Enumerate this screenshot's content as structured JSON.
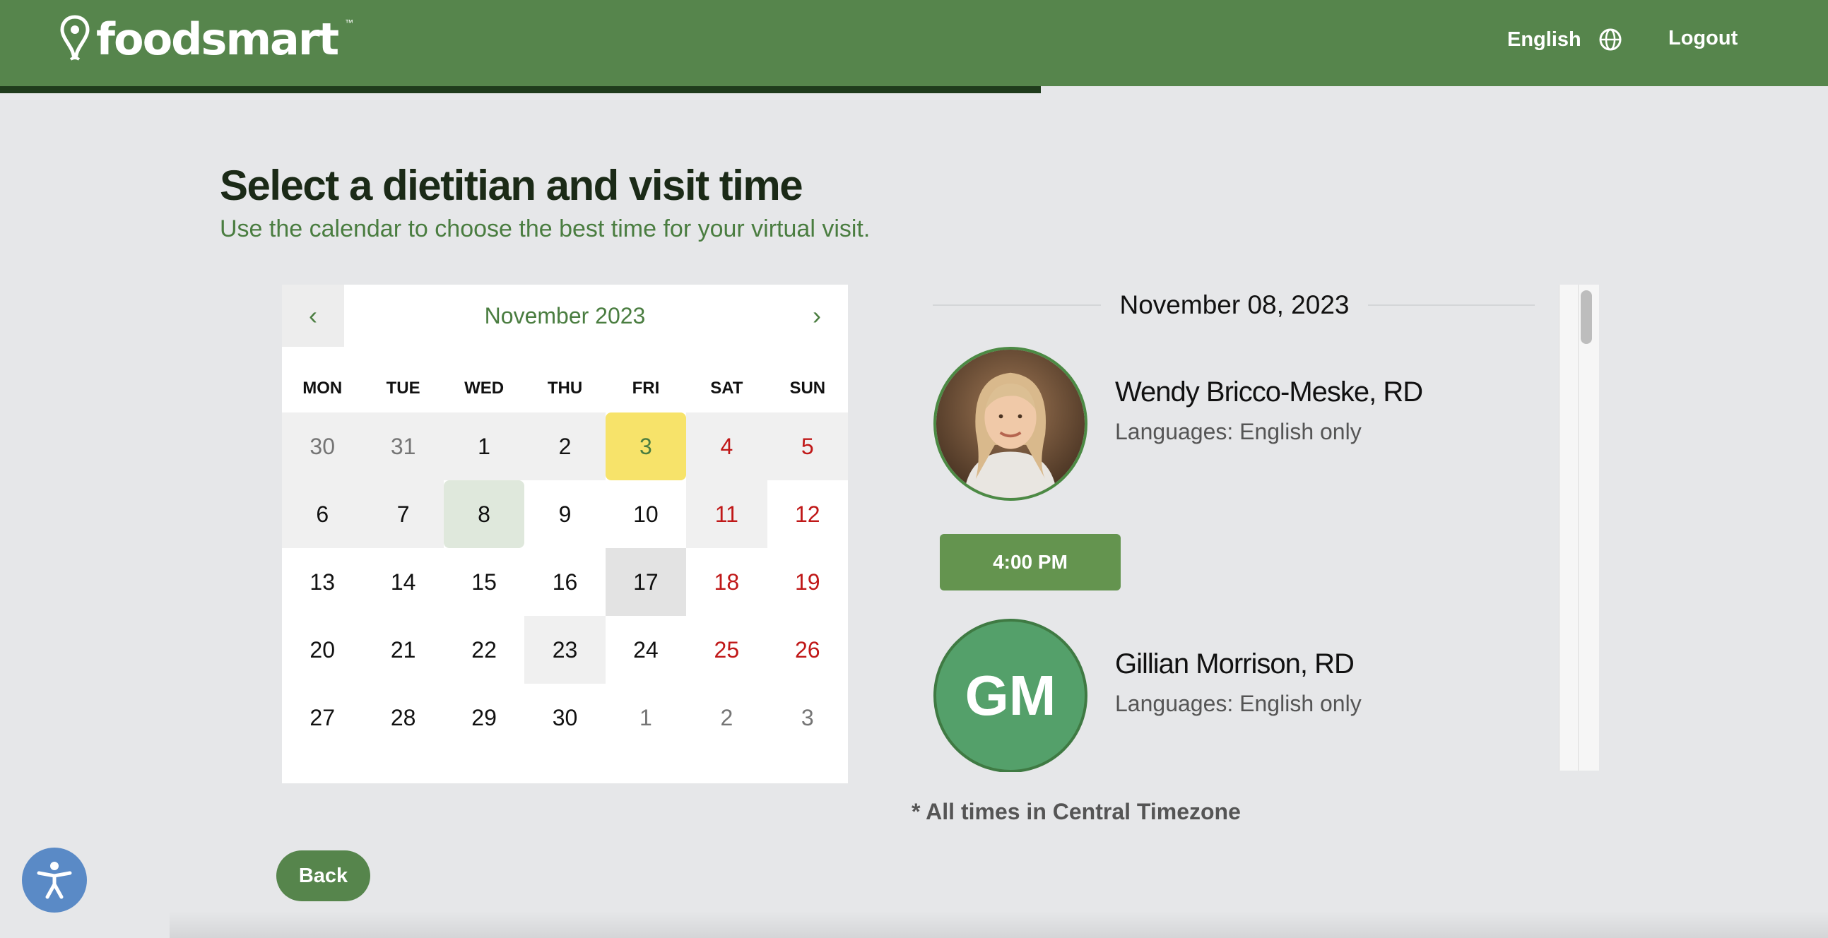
{
  "header": {
    "logo_text": "foodsmart",
    "logo_tm": "™",
    "language_label": "English",
    "logout_label": "Logout",
    "brand_color": "#56854c"
  },
  "page": {
    "title": "Select a dietitian and visit time",
    "subtitle": "Use the calendar to choose the best time for your virtual visit."
  },
  "calendar": {
    "prev_icon": "‹",
    "next_icon": "›",
    "month_label": "November 2023",
    "weekdays": [
      "MON",
      "TUE",
      "WED",
      "THU",
      "FRI",
      "SAT",
      "SUN"
    ],
    "days": [
      {
        "label": "30",
        "state": "muted",
        "shade": true
      },
      {
        "label": "31",
        "state": "muted",
        "shade": true
      },
      {
        "label": "1",
        "state": "normal",
        "shade": true
      },
      {
        "label": "2",
        "state": "normal",
        "shade": true
      },
      {
        "label": "3",
        "state": "today",
        "shade": true
      },
      {
        "label": "4",
        "state": "weekend",
        "shade": true
      },
      {
        "label": "5",
        "state": "weekend",
        "shade": true
      },
      {
        "label": "6",
        "state": "normal",
        "shade": true
      },
      {
        "label": "7",
        "state": "normal",
        "shade": true
      },
      {
        "label": "8",
        "state": "selected",
        "shade": false
      },
      {
        "label": "9",
        "state": "normal",
        "shade": false
      },
      {
        "label": "10",
        "state": "normal",
        "shade": false
      },
      {
        "label": "11",
        "state": "weekend",
        "shade": true
      },
      {
        "label": "12",
        "state": "weekend",
        "shade": false
      },
      {
        "label": "13",
        "state": "normal",
        "shade": false
      },
      {
        "label": "14",
        "state": "normal",
        "shade": false
      },
      {
        "label": "15",
        "state": "normal",
        "shade": false
      },
      {
        "label": "16",
        "state": "normal",
        "shade": false
      },
      {
        "label": "17",
        "state": "hover",
        "shade": false
      },
      {
        "label": "18",
        "state": "weekend",
        "shade": false
      },
      {
        "label": "19",
        "state": "weekend",
        "shade": false
      },
      {
        "label": "20",
        "state": "normal",
        "shade": false
      },
      {
        "label": "21",
        "state": "normal",
        "shade": false
      },
      {
        "label": "22",
        "state": "normal",
        "shade": false
      },
      {
        "label": "23",
        "state": "normal",
        "shade": true
      },
      {
        "label": "24",
        "state": "normal",
        "shade": false
      },
      {
        "label": "25",
        "state": "weekend",
        "shade": false
      },
      {
        "label": "26",
        "state": "weekend",
        "shade": false
      },
      {
        "label": "27",
        "state": "normal",
        "shade": false
      },
      {
        "label": "28",
        "state": "normal",
        "shade": false
      },
      {
        "label": "29",
        "state": "normal",
        "shade": false
      },
      {
        "label": "30",
        "state": "normal",
        "shade": false
      },
      {
        "label": "1",
        "state": "muted",
        "shade": false
      },
      {
        "label": "2",
        "state": "muted",
        "shade": false
      },
      {
        "label": "3",
        "state": "muted",
        "shade": false
      }
    ]
  },
  "schedule": {
    "date_heading": "November 08, 2023",
    "dietitians": [
      {
        "name": "Wendy Bricco-Meske, RD",
        "languages": "Languages: English only",
        "slots": [
          "4:00 PM"
        ]
      },
      {
        "name": "Gillian Morrison, RD",
        "languages": "Languages: English only",
        "initials": "GM"
      }
    ],
    "timezone_note": "* All times in Central Timezone"
  },
  "footer": {
    "back_label": "Back"
  }
}
